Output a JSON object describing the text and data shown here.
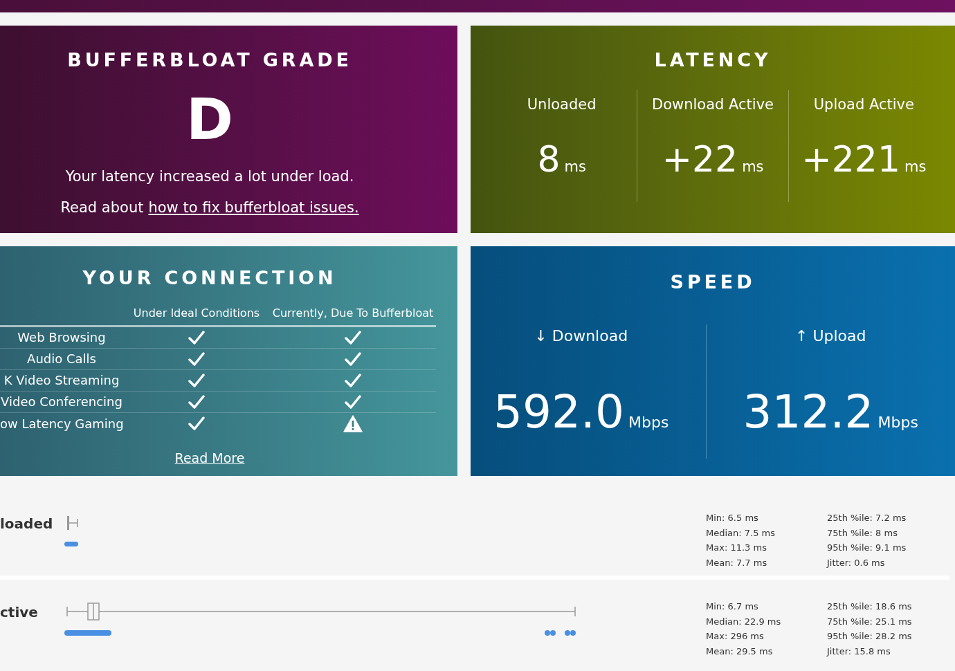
{
  "grade_card": {
    "title": "BUFFERBLOAT GRADE",
    "grade": "D",
    "message": "Your latency increased a lot under load.",
    "link_prefix": "Read about",
    "link": "how to fix bufferbloat issues."
  },
  "latency_card": {
    "title": "LATENCY",
    "columns": [
      {
        "label": "Unloaded",
        "value": "8",
        "unit": "ms"
      },
      {
        "label": "Download Active",
        "value": "+22",
        "unit": "ms"
      },
      {
        "label": "Upload Active",
        "value": "+221",
        "unit": "ms"
      }
    ]
  },
  "connection_card": {
    "title": "YOUR CONNECTION",
    "columns": [
      "Under Ideal Conditions",
      "Currently, Due To Bufferbloat"
    ],
    "rows": [
      {
        "label": "Web Browsing",
        "ideal_ok": true,
        "current_ok": true
      },
      {
        "label": "Audio Calls",
        "ideal_ok": true,
        "current_ok": true
      },
      {
        "label": "K Video Streaming",
        "ideal_ok": true,
        "current_ok": true
      },
      {
        "label": "Video Conferencing",
        "ideal_ok": true,
        "current_ok": true
      },
      {
        "label": "ow Latency Gaming",
        "ideal_ok": true,
        "current_ok": false
      }
    ],
    "link": "Read More"
  },
  "speed_card": {
    "title": "SPEED",
    "columns": [
      {
        "label": "↓ Download",
        "value": "592.0",
        "unit": "Mbps"
      },
      {
        "label": "↑ Upload",
        "value": "312.2",
        "unit": "Mbps"
      }
    ]
  },
  "latency_details": [
    {
      "label": "loaded",
      "kind": "narrow",
      "stats_left": [
        "Min: 6.5 ms",
        "Median: 7.5 ms",
        "Max: 11.3 ms",
        "Mean: 7.7 ms"
      ],
      "stats_right": [
        "25th %ile: 7.2 ms",
        "75th %ile: 8 ms",
        "95th %ile: 9.1 ms",
        "Jitter: 0.6 ms"
      ]
    },
    {
      "label": "ctive",
      "kind": "wide",
      "stats_left": [
        "Min: 6.7 ms",
        "Median: 22.9 ms",
        "Max: 296 ms",
        "Mean: 29.5 ms"
      ],
      "stats_right": [
        "25th %ile: 18.6 ms",
        "75th %ile: 25.1 ms",
        "95th %ile: 28.2 ms",
        "Jitter: 15.8 ms"
      ]
    }
  ]
}
